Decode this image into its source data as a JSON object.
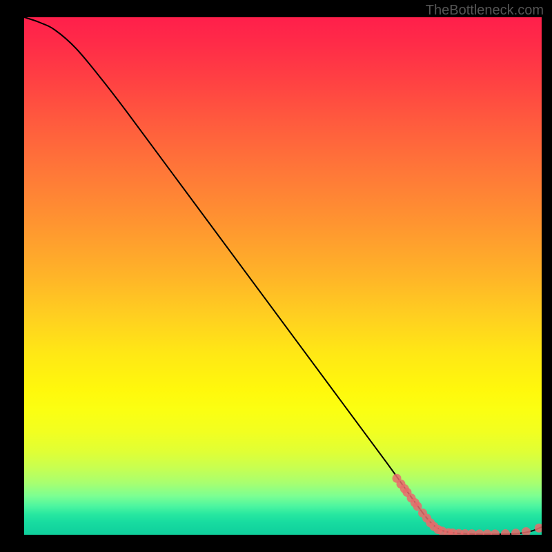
{
  "watermark": "TheBottleneck.com",
  "chart_data": {
    "type": "line",
    "title": "",
    "xlabel": "",
    "ylabel": "",
    "xlim": [
      0,
      100
    ],
    "ylim": [
      0,
      100
    ],
    "grid": false,
    "curve": [
      {
        "x": 0,
        "y": 100
      },
      {
        "x": 3,
        "y": 99
      },
      {
        "x": 6,
        "y": 97.5
      },
      {
        "x": 10,
        "y": 94
      },
      {
        "x": 15,
        "y": 88
      },
      {
        "x": 20,
        "y": 81.5
      },
      {
        "x": 30,
        "y": 68
      },
      {
        "x": 40,
        "y": 54.5
      },
      {
        "x": 50,
        "y": 41
      },
      {
        "x": 60,
        "y": 27.5
      },
      {
        "x": 70,
        "y": 14
      },
      {
        "x": 75,
        "y": 7
      },
      {
        "x": 78,
        "y": 3
      },
      {
        "x": 80,
        "y": 1.2
      },
      {
        "x": 82,
        "y": 0.5
      },
      {
        "x": 85,
        "y": 0.2
      },
      {
        "x": 90,
        "y": 0.1
      },
      {
        "x": 95,
        "y": 0.2
      },
      {
        "x": 98,
        "y": 0.7
      },
      {
        "x": 100,
        "y": 1.5
      }
    ],
    "scatter_points": [
      {
        "x": 72,
        "y": 10.9
      },
      {
        "x": 72.8,
        "y": 9.8
      },
      {
        "x": 73.5,
        "y": 8.9
      },
      {
        "x": 74,
        "y": 8.2
      },
      {
        "x": 74.8,
        "y": 7.1
      },
      {
        "x": 75.5,
        "y": 6.2
      },
      {
        "x": 76,
        "y": 5.5
      },
      {
        "x": 77,
        "y": 4.2
      },
      {
        "x": 77.8,
        "y": 3.2
      },
      {
        "x": 78.5,
        "y": 2.3
      },
      {
        "x": 79.2,
        "y": 1.6
      },
      {
        "x": 80,
        "y": 1.0
      },
      {
        "x": 80.8,
        "y": 0.7
      },
      {
        "x": 82,
        "y": 0.4
      },
      {
        "x": 82.8,
        "y": 0.35
      },
      {
        "x": 84,
        "y": 0.25
      },
      {
        "x": 85.2,
        "y": 0.2
      },
      {
        "x": 86.5,
        "y": 0.18
      },
      {
        "x": 88,
        "y": 0.15
      },
      {
        "x": 89.5,
        "y": 0.15
      },
      {
        "x": 91,
        "y": 0.15
      },
      {
        "x": 93,
        "y": 0.2
      },
      {
        "x": 95,
        "y": 0.3
      },
      {
        "x": 97,
        "y": 0.6
      },
      {
        "x": 99.5,
        "y": 1.3
      }
    ],
    "scatter_color": "#e96b6b",
    "line_color": "#000000"
  }
}
